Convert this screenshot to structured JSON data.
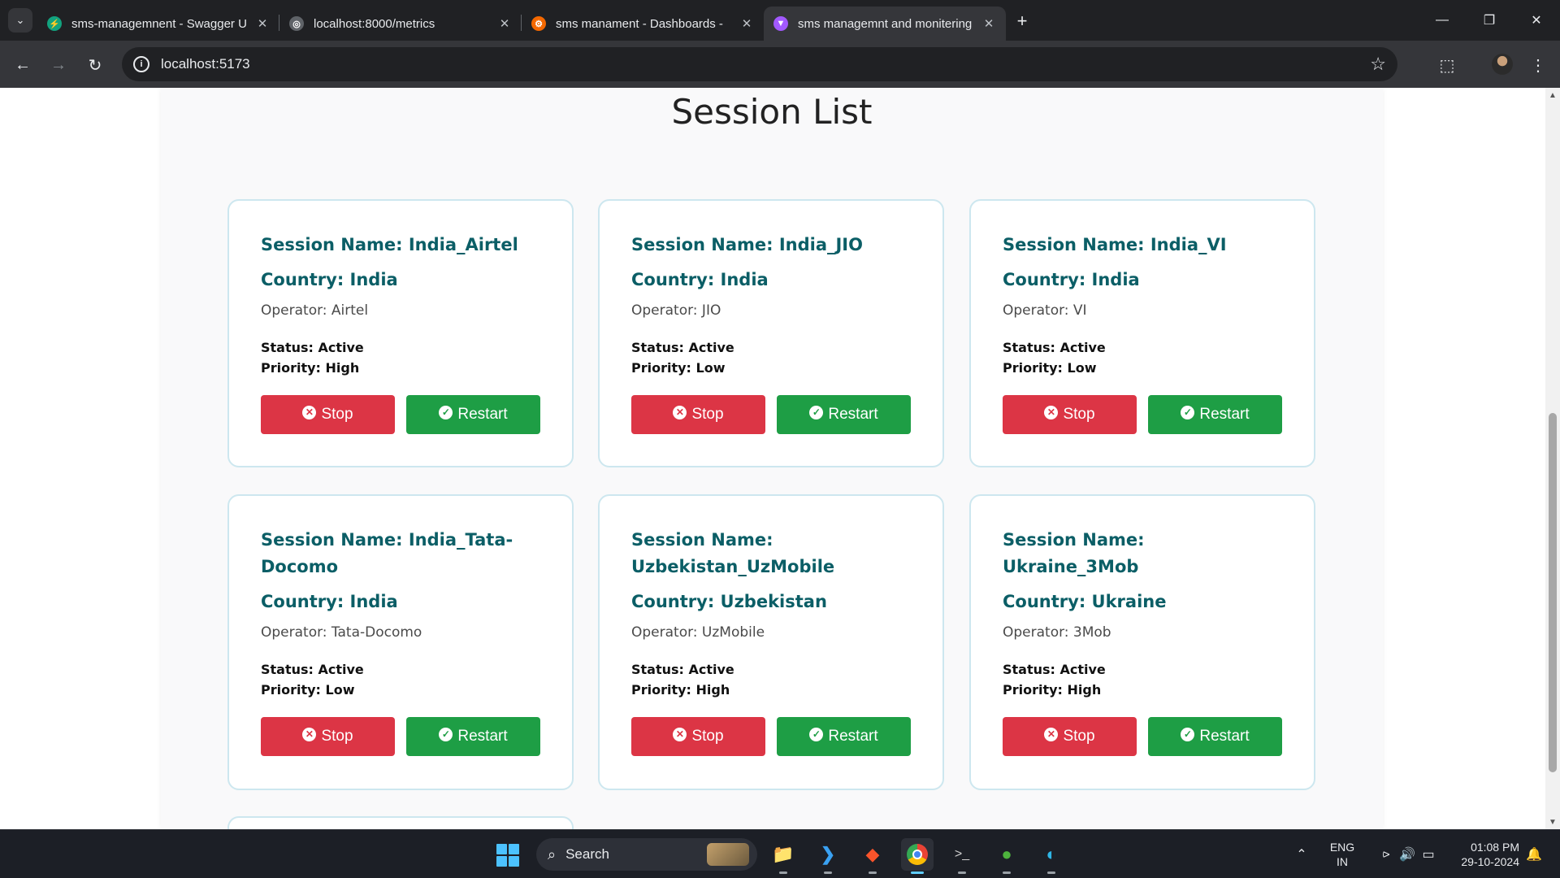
{
  "browser": {
    "tabs": [
      {
        "title": "sms-managemnent - Swagger U",
        "favicon_color": "#12a37f",
        "active": false
      },
      {
        "title": "localhost:8000/metrics",
        "favicon_color": "#5f6368",
        "active": false
      },
      {
        "title": "sms manament - Dashboards - ",
        "favicon_color": "#f46800",
        "active": false
      },
      {
        "title": "sms managemnt and monitering",
        "favicon_color": "#a259ff",
        "active": true
      }
    ],
    "url": "localhost:5173"
  },
  "page": {
    "title": "Session List",
    "sessions": [
      {
        "name": "Session Name: India_Airtel",
        "country": "Country: India",
        "operator": "Operator: Airtel",
        "status": "Status: Active",
        "priority": "Priority: High",
        "stop_label": "Stop",
        "restart_label": "Restart"
      },
      {
        "name": "Session Name: India_JIO",
        "country": "Country: India",
        "operator": "Operator: JIO",
        "status": "Status: Active",
        "priority": "Priority: Low",
        "stop_label": "Stop",
        "restart_label": "Restart"
      },
      {
        "name": "Session Name: India_VI",
        "country": "Country: India",
        "operator": "Operator: VI",
        "status": "Status: Active",
        "priority": "Priority: Low",
        "stop_label": "Stop",
        "restart_label": "Restart"
      },
      {
        "name": "Session Name: India_Tata-Docomo",
        "country": "Country: India",
        "operator": "Operator: Tata-Docomo",
        "status": "Status: Active",
        "priority": "Priority: Low",
        "stop_label": "Stop",
        "restart_label": "Restart"
      },
      {
        "name": "Session Name: Uzbekistan_UzMobile",
        "country": "Country: Uzbekistan",
        "operator": "Operator: UzMobile",
        "status": "Status: Active",
        "priority": "Priority: High",
        "stop_label": "Stop",
        "restart_label": "Restart"
      },
      {
        "name": "Session Name: Ukraine_3Mob",
        "country": "Country: Ukraine",
        "operator": "Operator: 3Mob",
        "status": "Status: Active",
        "priority": "Priority: High",
        "stop_label": "Stop",
        "restart_label": "Restart"
      }
    ],
    "colors": {
      "heading": "#0b5e66",
      "stop": "#dc3545",
      "restart": "#1e9e45"
    }
  },
  "taskbar": {
    "search_label": "Search",
    "apps": [
      "file-explorer-icon",
      "vscode-icon",
      "brave-icon",
      "chrome-icon",
      "terminal-icon",
      "mongodb-compass-icon",
      "edge-icon"
    ],
    "language": "ENG",
    "region": "IN",
    "time": "01:08 PM",
    "date": "29-10-2024"
  }
}
